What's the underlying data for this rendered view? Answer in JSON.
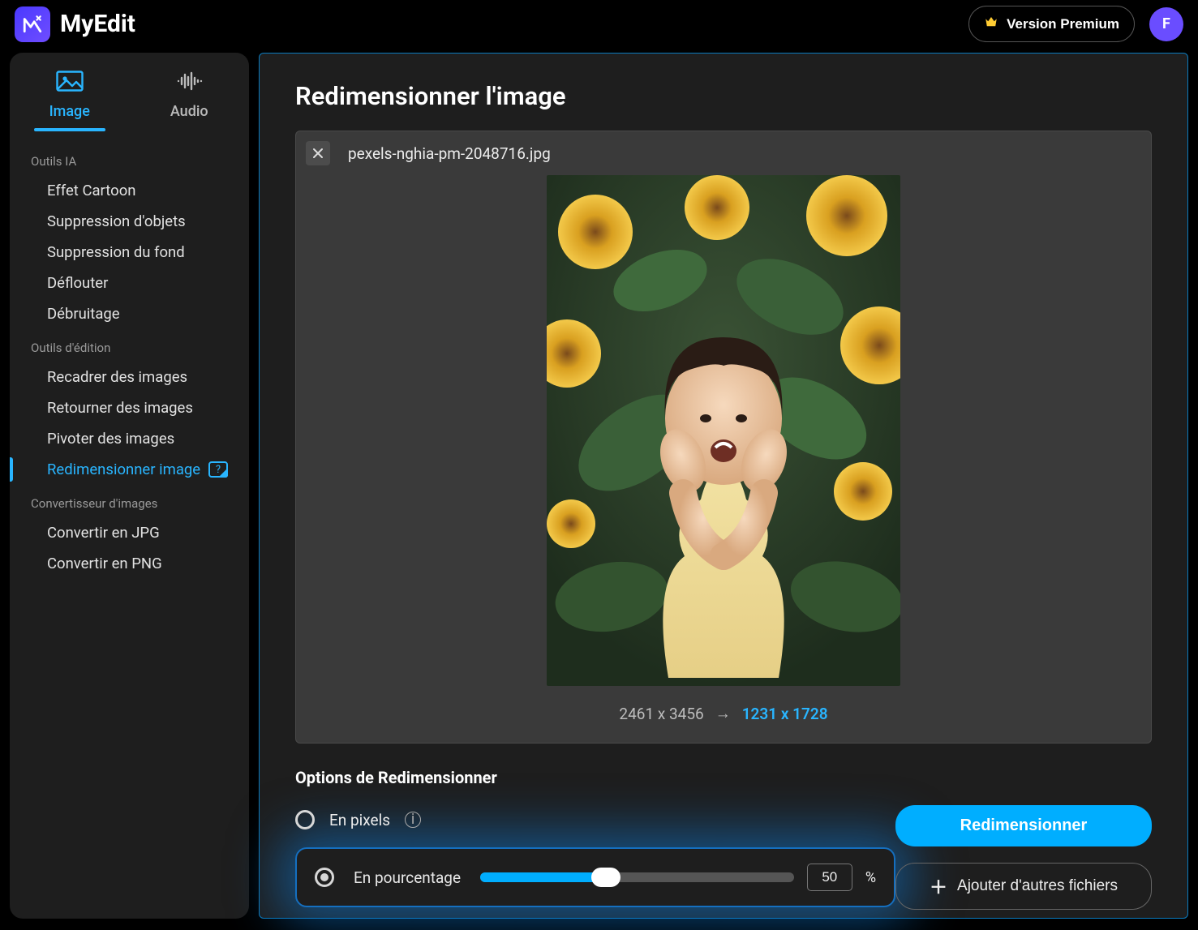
{
  "header": {
    "app_name": "MyEdit",
    "premium_label": "Version Premium",
    "avatar_letter": "F"
  },
  "sidebar": {
    "tabs": {
      "image": "Image",
      "audio": "Audio"
    },
    "groups": [
      {
        "title": "Outils IA",
        "items": [
          {
            "label": "Effet Cartoon"
          },
          {
            "label": "Suppression d'objets"
          },
          {
            "label": "Suppression du fond"
          },
          {
            "label": "Déflouter"
          },
          {
            "label": "Débruitage"
          }
        ]
      },
      {
        "title": "Outils d'édition",
        "items": [
          {
            "label": "Recadrer des images"
          },
          {
            "label": "Retourner des images"
          },
          {
            "label": "Pivoter des images"
          },
          {
            "label": "Redimensionner image",
            "active": true
          }
        ]
      },
      {
        "title": "Convertisseur d'images",
        "items": [
          {
            "label": "Convertir en JPG"
          },
          {
            "label": "Convertir en PNG"
          }
        ]
      }
    ]
  },
  "main": {
    "title": "Redimensionner l'image",
    "file_name": "pexels-nghia-pm-2048716.jpg",
    "dims_original": "2461 x 3456",
    "dims_new": "1231 x 1728",
    "options_title": "Options de Redimensionner",
    "option_pixels_label": "En pixels",
    "option_percent_label": "En pourcentage",
    "percent_value": "50",
    "percent_sign": "%",
    "primary_button": "Redimensionner",
    "secondary_button": "Ajouter d'autres fichiers"
  }
}
